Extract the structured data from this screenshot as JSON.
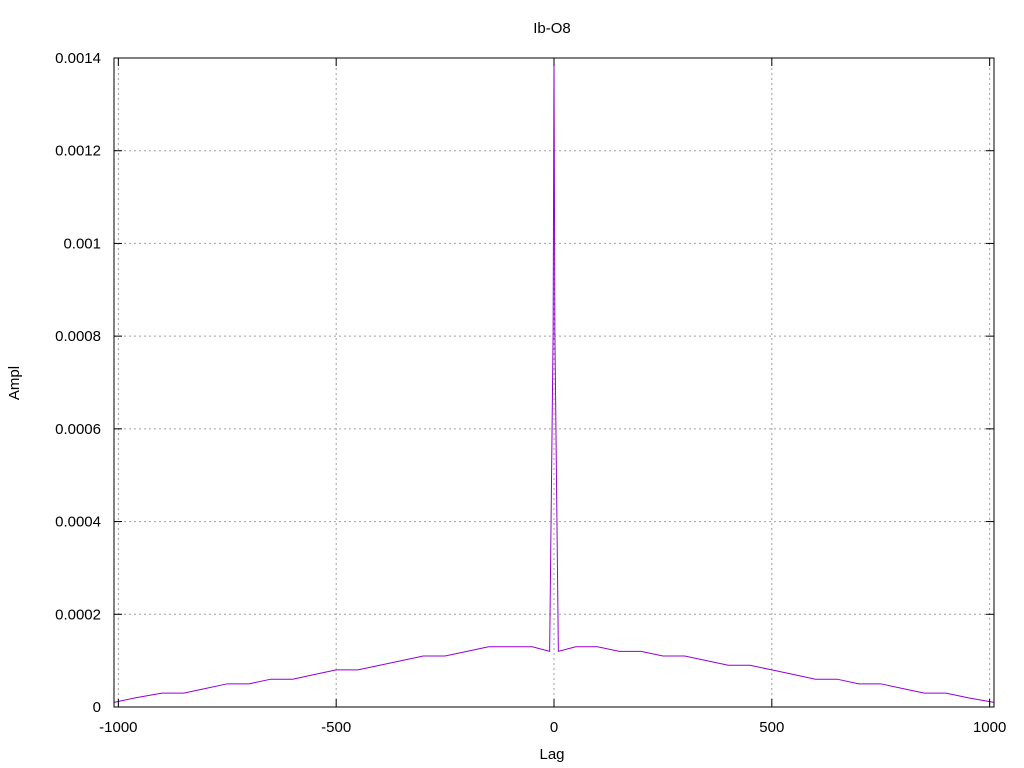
{
  "chart_data": {
    "type": "line",
    "title": "Ib-O8",
    "xlabel": "Lag",
    "ylabel": "Ampl",
    "xlim": [
      -1010,
      1010
    ],
    "ylim": [
      0,
      0.0014
    ],
    "xticks": [
      -1000,
      -500,
      0,
      500,
      1000
    ],
    "xtick_labels": [
      "-1000",
      "-500",
      "0",
      "500",
      "1000"
    ],
    "yticks": [
      0,
      0.0002,
      0.0004,
      0.0006,
      0.0008,
      0.001,
      0.0012,
      0.0014
    ],
    "ytick_labels": [
      "0",
      "0.0002",
      "0.0004",
      "0.0006",
      "0.0008",
      "0.001",
      "0.0012",
      "0.0014"
    ],
    "grid": true,
    "legend": "none",
    "series": [
      {
        "color": "#9400d3",
        "x": [
          -1010,
          -960,
          -900,
          -850,
          -800,
          -750,
          -700,
          -650,
          -600,
          -550,
          -500,
          -450,
          -400,
          -350,
          -300,
          -250,
          -200,
          -150,
          -100,
          -50,
          -10,
          -2,
          0,
          2,
          10,
          50,
          100,
          150,
          200,
          250,
          300,
          350,
          400,
          450,
          500,
          550,
          600,
          650,
          700,
          750,
          800,
          850,
          900,
          950,
          1010
        ],
        "y": [
          1e-05,
          2e-05,
          3e-05,
          3e-05,
          4e-05,
          5e-05,
          5e-05,
          6e-05,
          6e-05,
          7e-05,
          8e-05,
          8e-05,
          9e-05,
          0.0001,
          0.00011,
          0.00011,
          0.00012,
          0.00013,
          0.00013,
          0.00013,
          0.00012,
          0.00081,
          0.0014,
          0.00081,
          0.00012,
          0.00013,
          0.00013,
          0.00012,
          0.00012,
          0.00011,
          0.00011,
          0.0001,
          9e-05,
          9e-05,
          8e-05,
          7e-05,
          6e-05,
          6e-05,
          5e-05,
          5e-05,
          4e-05,
          3e-05,
          3e-05,
          2e-05,
          1e-05
        ]
      }
    ]
  }
}
